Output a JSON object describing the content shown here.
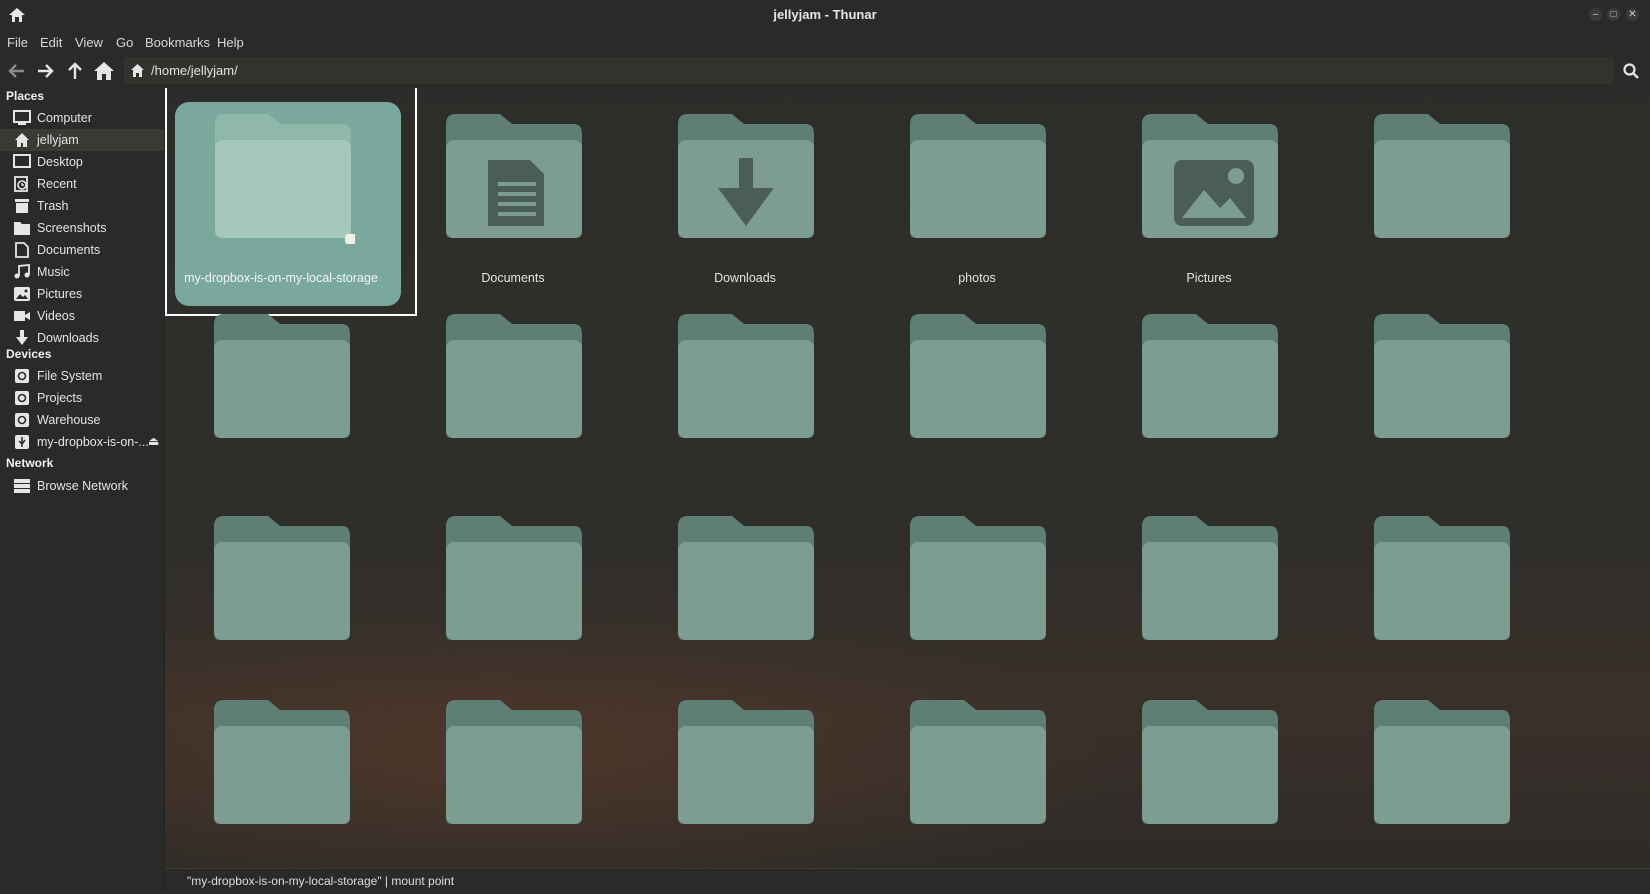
{
  "window": {
    "title": "jellyjam - Thunar"
  },
  "menu": [
    "File",
    "Edit",
    "View",
    "Go",
    "Bookmarks",
    "Help"
  ],
  "toolbar": {
    "path": "/home/jellyjam/"
  },
  "sidebar": {
    "places_header": "Places",
    "places": [
      {
        "label": "Computer",
        "icon": "computer-icon"
      },
      {
        "label": "jellyjam",
        "icon": "home-icon",
        "active": true
      },
      {
        "label": "Desktop",
        "icon": "desktop-icon"
      },
      {
        "label": "Recent",
        "icon": "recent-icon"
      },
      {
        "label": "Trash",
        "icon": "trash-icon"
      },
      {
        "label": "Screenshots",
        "icon": "folder-icon"
      },
      {
        "label": "Documents",
        "icon": "document-icon"
      },
      {
        "label": "Music",
        "icon": "music-icon"
      },
      {
        "label": "Pictures",
        "icon": "pictures-icon"
      },
      {
        "label": "Videos",
        "icon": "videos-icon"
      },
      {
        "label": "Downloads",
        "icon": "download-icon"
      }
    ],
    "devices_header": "Devices",
    "devices": [
      {
        "label": "File System",
        "icon": "drive-icon"
      },
      {
        "label": "Projects",
        "icon": "drive-icon"
      },
      {
        "label": "Warehouse",
        "icon": "drive-icon"
      },
      {
        "label": "my-dropbox-is-on-...",
        "icon": "usb-icon",
        "eject": "⏏"
      }
    ],
    "network_header": "Network",
    "network": [
      {
        "label": "Browse Network",
        "icon": "network-icon"
      }
    ]
  },
  "files": [
    {
      "name": "my-dropbox-is-on-my-local-storage",
      "emblem": "usb-icon",
      "selected": true
    },
    {
      "name": "Documents",
      "emblem": "document-icon"
    },
    {
      "name": "Downloads",
      "emblem": "download-icon"
    },
    {
      "name": "photos",
      "emblem": ""
    },
    {
      "name": "Pictures",
      "emblem": "pictures-icon"
    },
    {
      "name": "",
      "emblem": ""
    }
  ],
  "status": {
    "text": "\"my-dropbox-is-on-my-local-storage\"  |  mount point"
  },
  "colors": {
    "folder_back": "#5f7f75",
    "folder_front": "#7e9d92",
    "selection": "#7aa89c"
  }
}
